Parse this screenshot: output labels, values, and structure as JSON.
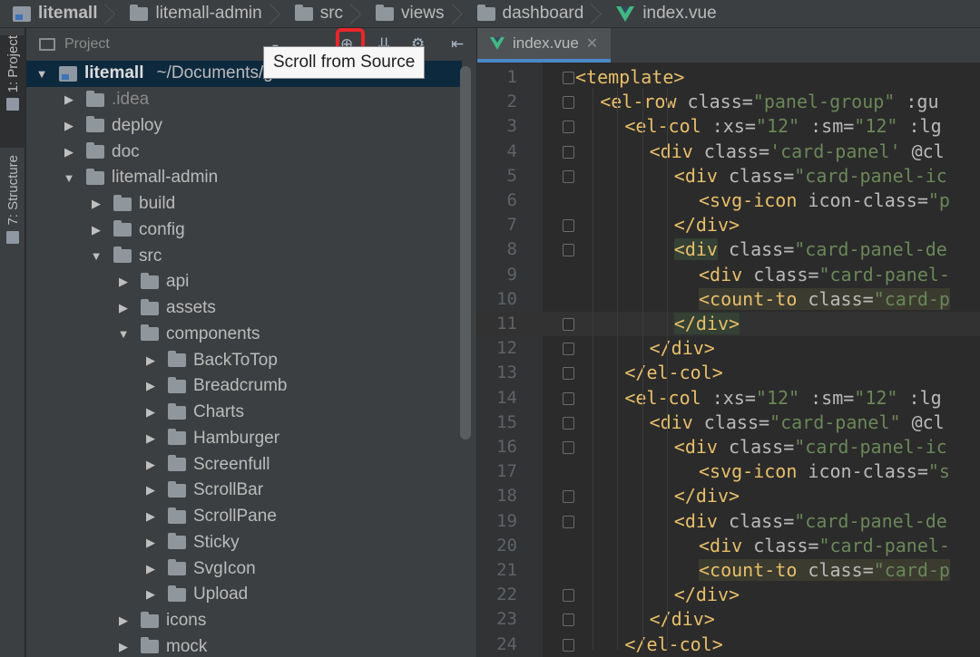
{
  "breadcrumb": [
    {
      "label": "litemall",
      "icon": "module-icon"
    },
    {
      "label": "litemall-admin",
      "icon": "folder-icon"
    },
    {
      "label": "src",
      "icon": "folder-icon"
    },
    {
      "label": "views",
      "icon": "folder-icon"
    },
    {
      "label": "dashboard",
      "icon": "folder-icon"
    },
    {
      "label": "index.vue",
      "icon": "vue-icon"
    }
  ],
  "tool_strip": {
    "project_tab": "1: Project",
    "structure_tab": "7: Structure"
  },
  "project_panel": {
    "title": "Project",
    "tooltip": "Scroll from Source",
    "highlight_color": "#e8262a",
    "tree": [
      {
        "label": "litemall",
        "extra": "~/Documents/github/litemall",
        "depth": 0,
        "expanded": true,
        "selected": true,
        "root": true
      },
      {
        "label": ".idea",
        "depth": 1,
        "expanded": false,
        "dim": true
      },
      {
        "label": "deploy",
        "depth": 1,
        "expanded": false
      },
      {
        "label": "doc",
        "depth": 1,
        "expanded": false
      },
      {
        "label": "litemall-admin",
        "depth": 1,
        "expanded": true
      },
      {
        "label": "build",
        "depth": 2,
        "expanded": false
      },
      {
        "label": "config",
        "depth": 2,
        "expanded": false
      },
      {
        "label": "src",
        "depth": 2,
        "expanded": true
      },
      {
        "label": "api",
        "depth": 3,
        "expanded": false
      },
      {
        "label": "assets",
        "depth": 3,
        "expanded": false
      },
      {
        "label": "components",
        "depth": 3,
        "expanded": true
      },
      {
        "label": "BackToTop",
        "depth": 4,
        "expanded": false
      },
      {
        "label": "Breadcrumb",
        "depth": 4,
        "expanded": false
      },
      {
        "label": "Charts",
        "depth": 4,
        "expanded": false
      },
      {
        "label": "Hamburger",
        "depth": 4,
        "expanded": false
      },
      {
        "label": "Screenfull",
        "depth": 4,
        "expanded": false
      },
      {
        "label": "ScrollBar",
        "depth": 4,
        "expanded": false
      },
      {
        "label": "ScrollPane",
        "depth": 4,
        "expanded": false
      },
      {
        "label": "Sticky",
        "depth": 4,
        "expanded": false
      },
      {
        "label": "SvgIcon",
        "depth": 4,
        "expanded": false
      },
      {
        "label": "Upload",
        "depth": 4,
        "expanded": false
      },
      {
        "label": "icons",
        "depth": 3,
        "expanded": false
      },
      {
        "label": "mock",
        "depth": 3,
        "expanded": false
      }
    ]
  },
  "editor": {
    "tab_label": "index.vue",
    "current_line": 11,
    "lines": [
      {
        "n": "1",
        "indent": 0,
        "fold": true,
        "parts": [
          [
            "tag",
            "<template>"
          ]
        ]
      },
      {
        "n": "2",
        "indent": 1,
        "fold": true,
        "parts": [
          [
            "tag",
            "<"
          ],
          [
            "tag",
            "el-row"
          ],
          [
            "attr",
            " class="
          ],
          [
            "str",
            "\"panel-group\""
          ],
          [
            "attr",
            " :gu"
          ]
        ]
      },
      {
        "n": "3",
        "indent": 2,
        "fold": true,
        "parts": [
          [
            "tag",
            "<el-col"
          ],
          [
            "attr",
            " :xs="
          ],
          [
            "str",
            "\"12\""
          ],
          [
            "attr",
            " :sm="
          ],
          [
            "str",
            "\"12\""
          ],
          [
            "attr",
            " :lg"
          ]
        ]
      },
      {
        "n": "4",
        "indent": 3,
        "fold": true,
        "parts": [
          [
            "tag",
            "<div"
          ],
          [
            "attr",
            " class="
          ],
          [
            "str",
            "'card-panel'"
          ],
          [
            "attr",
            " @cl"
          ]
        ]
      },
      {
        "n": "5",
        "indent": 4,
        "fold": true,
        "parts": [
          [
            "tag",
            "<div"
          ],
          [
            "attr",
            " class="
          ],
          [
            "str",
            "\"card-panel-ic"
          ]
        ]
      },
      {
        "n": "6",
        "indent": 5,
        "fold": false,
        "parts": [
          [
            "tag",
            "<svg-icon"
          ],
          [
            "attr",
            " icon-class="
          ],
          [
            "str",
            "\"p"
          ]
        ]
      },
      {
        "n": "7",
        "indent": 4,
        "fold": true,
        "parts": [
          [
            "tag",
            "</div>"
          ]
        ]
      },
      {
        "n": "8",
        "indent": 4,
        "fold": true,
        "hl": true,
        "parts": [
          [
            "tag",
            "<div"
          ],
          [
            "attr",
            " class="
          ],
          [
            "str",
            "\"card-panel-de"
          ]
        ]
      },
      {
        "n": "9",
        "indent": 5,
        "fold": false,
        "parts": [
          [
            "tag",
            "<div"
          ],
          [
            "attr",
            " class="
          ],
          [
            "str",
            "\"card-panel-"
          ]
        ]
      },
      {
        "n": "10",
        "indent": 5,
        "fold": false,
        "hlall": true,
        "parts": [
          [
            "tag",
            "<count-to"
          ],
          [
            "attr",
            " class="
          ],
          [
            "str",
            "\"card-p"
          ]
        ]
      },
      {
        "n": "11",
        "indent": 4,
        "fold": true,
        "hl": true,
        "parts": [
          [
            "tag",
            "</div>"
          ]
        ]
      },
      {
        "n": "12",
        "indent": 3,
        "fold": true,
        "parts": [
          [
            "tag",
            "</div>"
          ]
        ]
      },
      {
        "n": "13",
        "indent": 2,
        "fold": true,
        "parts": [
          [
            "tag",
            "</el-col>"
          ]
        ]
      },
      {
        "n": "14",
        "indent": 2,
        "fold": true,
        "parts": [
          [
            "tag",
            "<el-col"
          ],
          [
            "attr",
            " :xs="
          ],
          [
            "str",
            "\"12\""
          ],
          [
            "attr",
            " :sm="
          ],
          [
            "str",
            "\"12\""
          ],
          [
            "attr",
            " :lg"
          ]
        ]
      },
      {
        "n": "15",
        "indent": 3,
        "fold": true,
        "parts": [
          [
            "tag",
            "<div"
          ],
          [
            "attr",
            " class="
          ],
          [
            "str",
            "\"card-panel\""
          ],
          [
            "attr",
            " @cl"
          ]
        ]
      },
      {
        "n": "16",
        "indent": 4,
        "fold": true,
        "parts": [
          [
            "tag",
            "<div"
          ],
          [
            "attr",
            " class="
          ],
          [
            "str",
            "\"card-panel-ic"
          ]
        ]
      },
      {
        "n": "17",
        "indent": 5,
        "fold": false,
        "parts": [
          [
            "tag",
            "<svg-icon"
          ],
          [
            "attr",
            " icon-class="
          ],
          [
            "str",
            "\"s"
          ]
        ]
      },
      {
        "n": "18",
        "indent": 4,
        "fold": true,
        "parts": [
          [
            "tag",
            "</div>"
          ]
        ]
      },
      {
        "n": "19",
        "indent": 4,
        "fold": true,
        "parts": [
          [
            "tag",
            "<div"
          ],
          [
            "attr",
            " class="
          ],
          [
            "str",
            "\"card-panel-de"
          ]
        ]
      },
      {
        "n": "20",
        "indent": 5,
        "fold": false,
        "parts": [
          [
            "tag",
            "<div"
          ],
          [
            "attr",
            " class="
          ],
          [
            "str",
            "\"card-panel-"
          ]
        ]
      },
      {
        "n": "21",
        "indent": 5,
        "fold": false,
        "hlall": true,
        "parts": [
          [
            "tag",
            "<count-to"
          ],
          [
            "attr",
            " class="
          ],
          [
            "str",
            "\"card-p"
          ]
        ]
      },
      {
        "n": "22",
        "indent": 4,
        "fold": true,
        "parts": [
          [
            "tag",
            "</div>"
          ]
        ]
      },
      {
        "n": "23",
        "indent": 3,
        "fold": true,
        "parts": [
          [
            "tag",
            "</div>"
          ]
        ]
      },
      {
        "n": "24",
        "indent": 2,
        "fold": true,
        "parts": [
          [
            "tag",
            "</el-col>"
          ]
        ]
      }
    ]
  }
}
